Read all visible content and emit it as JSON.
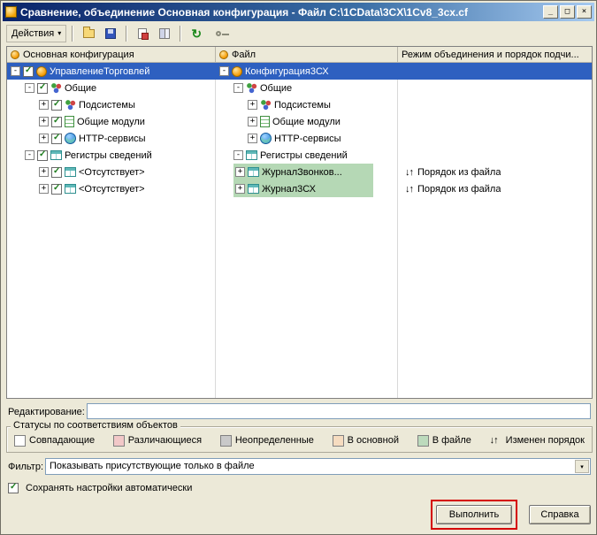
{
  "window": {
    "title": "Сравнение, объединение Основная конфигурация - Файл C:\\1CData\\3CX\\1Cv8_3cx.cf",
    "controls": {
      "minimize": "_",
      "maximize": "□",
      "close": "×"
    }
  },
  "toolbar": {
    "actions_label": "Действия",
    "actions_arrow": "▾",
    "refresh_glyph": "↻",
    "icons": [
      "open-folder-icon",
      "save-icon",
      "compare-report-icon",
      "columns-icon",
      "refresh-icon",
      "key-icon"
    ]
  },
  "tree": {
    "headers": [
      {
        "label": "Основная конфигурация"
      },
      {
        "label": "Файл"
      },
      {
        "label": "Режим объединения и порядок подчи..."
      }
    ],
    "order_icon": "↓↑",
    "rows": [
      {
        "expand": "-",
        "left": {
          "label": "УправлениеТорговлей"
        },
        "right": {
          "label": "Конфигурация3СХ"
        },
        "mode": ""
      },
      {
        "expand": "-",
        "left": {
          "label": "Общие"
        },
        "right": {
          "label": "Общие"
        },
        "mode": ""
      },
      {
        "expand": "+",
        "left": {
          "label": "Подсистемы"
        },
        "right": {
          "label": "Подсистемы"
        },
        "mode": ""
      },
      {
        "expand": "+",
        "left": {
          "label": "Общие модули"
        },
        "right": {
          "label": "Общие модули"
        },
        "mode": ""
      },
      {
        "expand": "+",
        "left": {
          "label": "HTTP-сервисы"
        },
        "right": {
          "label": "HTTP-сервисы"
        },
        "mode": ""
      },
      {
        "expand": "-",
        "left": {
          "label": "Регистры сведений"
        },
        "right": {
          "label": "Регистры сведений"
        },
        "mode": ""
      },
      {
        "expand": "+",
        "left": {
          "label": "<Отсутствует>"
        },
        "right": {
          "label": "ЖурналЗвонков..."
        },
        "mode": "Порядок из файла"
      },
      {
        "expand": "+",
        "left": {
          "label": "<Отсутствует>"
        },
        "right": {
          "label": "Журнал3СХ"
        },
        "mode": "Порядок из файла"
      }
    ]
  },
  "editing": {
    "label": "Редактирование:",
    "value": ""
  },
  "statuses": {
    "title": "Статусы по соответствиям объектов",
    "legend": [
      {
        "label": "Совпадающие",
        "color": "#ffffff"
      },
      {
        "label": "Различающиеся",
        "color": "#f2c8c8"
      },
      {
        "label": "Неопределенные",
        "color": "#c9c9c9"
      },
      {
        "label": "В основной",
        "color": "#f6dcc0"
      },
      {
        "label": "В файле",
        "color": "#bcdabc"
      }
    ],
    "order_changed_icon": "↓↑",
    "order_changed_label": "Изменен порядок"
  },
  "filter": {
    "label": "Фильтр:",
    "value": "Показывать присутствующие только в файле",
    "arrow": "▾"
  },
  "autosave": {
    "label": "Сохранять настройки автоматически",
    "checked": true,
    "check_glyph": "✓"
  },
  "buttons": {
    "execute": "Выполнить",
    "help": "Справка"
  },
  "colors": {
    "selection": "#2e60c0",
    "file_highlight": "#b5d8b5",
    "annotation": "#d40000",
    "titlebar_start": "#0a246a",
    "titlebar_end": "#a6caf0",
    "window_background": "#ece9d8"
  }
}
